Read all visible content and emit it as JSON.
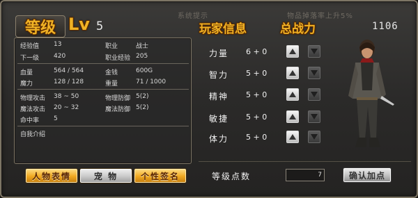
{
  "header": {
    "level_tab": "等级",
    "lv_label": "Lv",
    "lv_value": "5",
    "faded_left": "系统提示",
    "faded_right": "物品掉落率上升5%",
    "player_info": "玩家信息",
    "total_power": "总战力",
    "total_power_value": "1106"
  },
  "info": {
    "rows": [
      {
        "k": "经验值",
        "v": "13",
        "k2": "职业",
        "v2": "战士"
      },
      {
        "k": "下一级",
        "v": "420",
        "k2": "职业经验",
        "v2": "205"
      },
      {
        "k": "血量",
        "v": "564 / 564",
        "k2": "金钱",
        "v2": "600G"
      },
      {
        "k": "魔力",
        "v": "128 / 128",
        "k2": "重量",
        "v2": "71 / 1000"
      },
      {
        "k": "物理攻击",
        "v": "38 ~ 50",
        "k2": "物理防御",
        "v2": "5(2)"
      },
      {
        "k": "魔法攻击",
        "v": "20 ~ 32",
        "k2": "魔法防御",
        "v2": "5(2)"
      },
      {
        "k": "命中率",
        "v": "5",
        "k2": "",
        "v2": ""
      }
    ],
    "self_intro": "自我介绍"
  },
  "footer_buttons": {
    "emote": "人物表情",
    "pet": "宠 物",
    "signature": "个性签名"
  },
  "stats": [
    {
      "name": "力量",
      "value": "6 + 0"
    },
    {
      "name": "智力",
      "value": "5 + 0"
    },
    {
      "name": "精神",
      "value": "5 + 0"
    },
    {
      "name": "敏捷",
      "value": "5 + 0"
    },
    {
      "name": "体力",
      "value": "5 + 0"
    }
  ],
  "points": {
    "label": "等级点数",
    "value": "7",
    "confirm": "确认加点"
  },
  "colors": {
    "gold_text": "#f0b225",
    "gold_button": "#f0a820",
    "panel_border": "#7d7565"
  },
  "icons": {
    "increase": "triangle-up-icon",
    "decrease": "triangle-down-icon"
  }
}
